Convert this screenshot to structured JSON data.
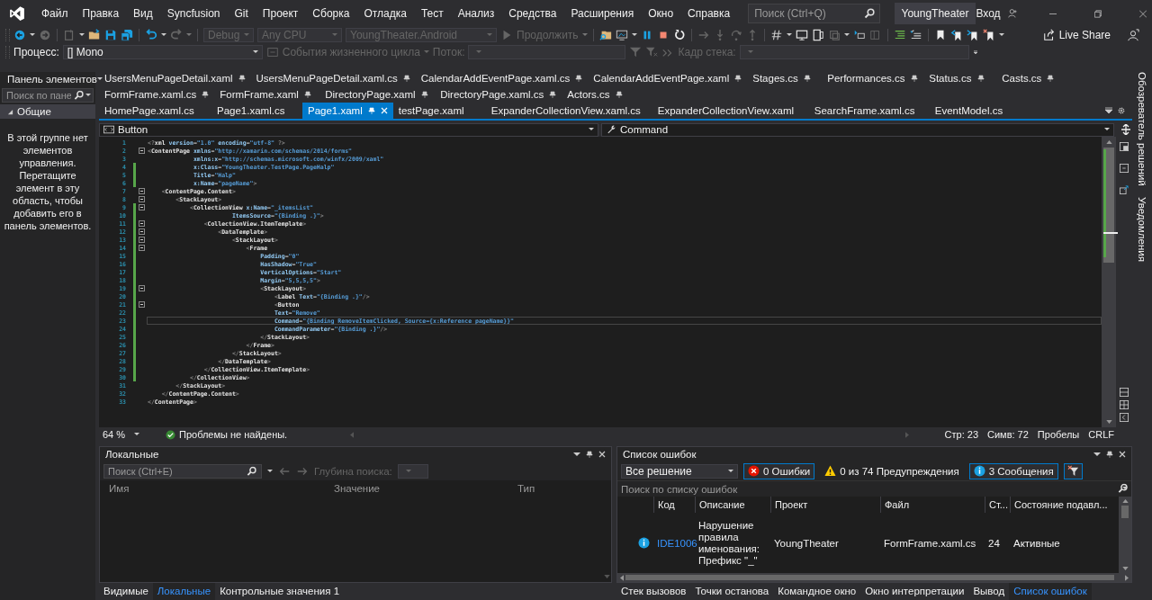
{
  "menu_bar": {
    "items": [
      "Файл",
      "Правка",
      "Вид",
      "Syncfusion",
      "Git",
      "Проект",
      "Сборка",
      "Отладка",
      "Тест",
      "Анализ",
      "Средства",
      "Расширения",
      "Окно",
      "Справка"
    ],
    "search": {
      "placeholder": "Поиск (Ctrl+Q)"
    },
    "solution_name": "YoungTheater",
    "sign_in": "Вход"
  },
  "toolbar": {
    "configuration": "Debug",
    "platform": "Any CPU",
    "startup_project": "YoungTheater.Android",
    "continue": "Продолжить",
    "live_share": "Live Share"
  },
  "debug_location": {
    "process_label": "Процесс:",
    "process": "[] Mono",
    "lifecycle_events": "События жизненного цикла",
    "thread_label": "Поток:",
    "stack_frame_label": "Кадр стека:"
  },
  "toolbox": {
    "title": "Панель элементов",
    "search": {
      "placeholder": "Поиск по пане"
    },
    "group": {
      "label": "Общие",
      "expanded": true
    },
    "empty_message": "В этой группе нет элементов управления. Перетащите элемент в эту область, чтобы добавить его в панель элементов."
  },
  "document_tabs": [
    [
      {
        "label": "UsersMenuPageDetail.xaml",
        "pinned": true,
        "selected": false
      },
      {
        "label": "UsersMenuPageDetail.xaml.cs",
        "pinned": true,
        "selected": false
      },
      {
        "label": "CalendarAddEventPage.xaml.cs",
        "pinned": true,
        "selected": false
      },
      {
        "label": "CalendarAddEventPage.xaml",
        "pinned": true,
        "selected": false
      },
      {
        "label": "Stages.cs",
        "pinned": true,
        "selected": false
      },
      {
        "label": "Performances.cs",
        "pinned": true,
        "selected": false
      },
      {
        "label": "Status.cs",
        "pinned": true,
        "selected": false
      },
      {
        "label": "Casts.cs",
        "pinned": true,
        "selected": false
      }
    ],
    [
      {
        "label": "FormFrame.xaml.cs",
        "pinned": true,
        "selected": false
      },
      {
        "label": "FormFrame.xaml",
        "pinned": true,
        "selected": false
      },
      {
        "label": "DirectoryPage.xaml",
        "pinned": true,
        "selected": false
      },
      {
        "label": "DirectoryPage.xaml.cs",
        "pinned": true,
        "selected": false
      },
      {
        "label": "Actors.cs",
        "pinned": true,
        "selected": false
      }
    ],
    [
      {
        "label": "HomePage.xaml.cs",
        "pinned": false,
        "selected": false
      },
      {
        "label": "Page1.xaml.cs",
        "pinned": false,
        "selected": false
      },
      {
        "label": "Page1.xaml",
        "pinned": true,
        "selected": true
      },
      {
        "label": "testPage.xaml",
        "pinned": false,
        "selected": false
      },
      {
        "label": "ExpanderCollectionView.xaml.cs",
        "pinned": false,
        "selected": false
      },
      {
        "label": "ExpanderCollectionView.xaml",
        "pinned": false,
        "selected": false
      },
      {
        "label": "SearchFrame.xaml.cs",
        "pinned": false,
        "selected": false
      },
      {
        "label": "EventModel.cs",
        "pinned": false,
        "selected": false
      }
    ]
  ],
  "navigation_bar": {
    "element": "Button",
    "member": "Command"
  },
  "code_lines": [
    {
      "number": "1",
      "text": "<?xml version=\"1.0\" encoding=\"utf-8\" ?>",
      "changed": false,
      "fold": false,
      "current": false
    },
    {
      "number": "2",
      "text": "<ContentPage xmlns=\"http://xamarin.com/schemas/2014/forms\"",
      "changed": false,
      "fold": true,
      "current": false
    },
    {
      "number": "3",
      "text": "             xmlns:x=\"http://schemas.microsoft.com/winfx/2009/xaml\"",
      "changed": false,
      "fold": false,
      "current": false
    },
    {
      "number": "4",
      "text": "             x:Class=\"YoungTheater.TestPage.PageHalp\"",
      "changed": true,
      "fold": false,
      "current": false
    },
    {
      "number": "5",
      "text": "             Title=\"Halp\"",
      "changed": true,
      "fold": false,
      "current": false
    },
    {
      "number": "6",
      "text": "             x:Name=\"pageName\">",
      "changed": true,
      "fold": false,
      "current": false
    },
    {
      "number": "7",
      "text": "    <ContentPage.Content>",
      "changed": false,
      "fold": true,
      "current": false
    },
    {
      "number": "8",
      "text": "        <StackLayout>",
      "changed": false,
      "fold": true,
      "current": false
    },
    {
      "number": "9",
      "text": "            <CollectionView x:Name=\"_itemsList\"",
      "changed": true,
      "fold": true,
      "current": false
    },
    {
      "number": "10",
      "text": "                        ItemsSource=\"{Binding .}\">",
      "changed": true,
      "fold": false,
      "current": false
    },
    {
      "number": "11",
      "text": "                <CollectionView.ItemTemplate>",
      "changed": true,
      "fold": true,
      "current": false
    },
    {
      "number": "12",
      "text": "                    <DataTemplate>",
      "changed": true,
      "fold": true,
      "current": false
    },
    {
      "number": "13",
      "text": "                        <StackLayout>",
      "changed": true,
      "fold": true,
      "current": false
    },
    {
      "number": "14",
      "text": "                            <Frame",
      "changed": true,
      "fold": true,
      "current": false
    },
    {
      "number": "15",
      "text": "                                Padding=\"0\"",
      "changed": true,
      "fold": false,
      "current": false
    },
    {
      "number": "16",
      "text": "                                HasShadow=\"True\"",
      "changed": true,
      "fold": false,
      "current": false
    },
    {
      "number": "17",
      "text": "                                VerticalOptions=\"Start\"",
      "changed": true,
      "fold": false,
      "current": false
    },
    {
      "number": "18",
      "text": "                                Margin=\"5,5,5,5\">",
      "changed": true,
      "fold": false,
      "current": false
    },
    {
      "number": "19",
      "text": "                                <StackLayout>",
      "changed": true,
      "fold": true,
      "current": false
    },
    {
      "number": "20",
      "text": "                                    <Label Text=\"{Binding .}\"/>",
      "changed": true,
      "fold": false,
      "current": false
    },
    {
      "number": "21",
      "text": "                                    <Button",
      "changed": true,
      "fold": true,
      "current": false
    },
    {
      "number": "22",
      "text": "                                    Text=\"Remove\"",
      "changed": true,
      "fold": false,
      "current": false
    },
    {
      "number": "23",
      "text": "                                    Command=\"{Binding RemoveItemClicked, Source={x:Reference pageName}}\"",
      "changed": true,
      "fold": false,
      "current": true
    },
    {
      "number": "24",
      "text": "                                    CommandParameter=\"{Binding .}\"/>",
      "changed": true,
      "fold": false,
      "current": false
    },
    {
      "number": "25",
      "text": "                                </StackLayout>",
      "changed": true,
      "fold": false,
      "current": false
    },
    {
      "number": "26",
      "text": "                            </Frame>",
      "changed": true,
      "fold": false,
      "current": false
    },
    {
      "number": "27",
      "text": "                        </StackLayout>",
      "changed": true,
      "fold": false,
      "current": false
    },
    {
      "number": "28",
      "text": "                    </DataTemplate>",
      "changed": true,
      "fold": false,
      "current": false
    },
    {
      "number": "29",
      "text": "                </CollectionView.ItemTemplate>",
      "changed": true,
      "fold": false,
      "current": false
    },
    {
      "number": "30",
      "text": "            </CollectionView>",
      "changed": true,
      "fold": false,
      "current": false
    },
    {
      "number": "31",
      "text": "        </StackLayout>",
      "changed": false,
      "fold": false,
      "current": false
    },
    {
      "number": "32",
      "text": "    </ContentPage.Content>",
      "changed": false,
      "fold": false,
      "current": false
    },
    {
      "number": "33",
      "text": "</ContentPage>",
      "changed": false,
      "fold": false,
      "current": false
    }
  ],
  "editor_status": {
    "zoom": "64 %",
    "issues": "Проблемы не найдены.",
    "line": "Стр: 23",
    "column": "Симв: 72",
    "indent": "Пробелы",
    "line_endings": "CRLF"
  },
  "locals_panel": {
    "title": "Локальные",
    "search": {
      "placeholder": "Поиск (Ctrl+E)"
    },
    "depth_label": "Глубина поиска:",
    "columns": [
      "Имя",
      "Значение",
      "Тип"
    ]
  },
  "error_list": {
    "title": "Список ошибок",
    "scope": "Все решение",
    "filters": [
      {
        "kind": "error",
        "label": "0 Ошибки",
        "selected": true
      },
      {
        "kind": "warning",
        "label": "0 из 74 Предупреждения",
        "selected": false
      },
      {
        "kind": "message",
        "label": "3 Сообщения",
        "selected": true
      }
    ],
    "search": {
      "placeholder": "Поиск по списку ошибок"
    },
    "columns": [
      "Код",
      "Описание",
      "Проект",
      "Файл",
      "Ст...",
      "Состояние подавл..."
    ],
    "rows": [
      {
        "code": "IDE1006",
        "description": "Нарушение правила именования: Префикс \"_\"",
        "project": "YoungTheater",
        "file": "FormFrame.xaml.cs",
        "line": "24",
        "state": "Активные"
      }
    ]
  },
  "bottom_tabs_left": [
    {
      "label": "Видимые",
      "selected": false
    },
    {
      "label": "Локальные",
      "selected": true
    },
    {
      "label": "Контрольные значения 1",
      "selected": false
    }
  ],
  "bottom_tabs_right": [
    {
      "label": "Стек вызовов",
      "selected": false
    },
    {
      "label": "Точки останова",
      "selected": false
    },
    {
      "label": "Командное окно",
      "selected": false
    },
    {
      "label": "Окно интерпретации",
      "selected": false
    },
    {
      "label": "Вывод",
      "selected": false
    },
    {
      "label": "Список ошибок",
      "selected": true
    }
  ],
  "side_tabs": [
    "Обозреватель решений",
    "Уведомления"
  ]
}
